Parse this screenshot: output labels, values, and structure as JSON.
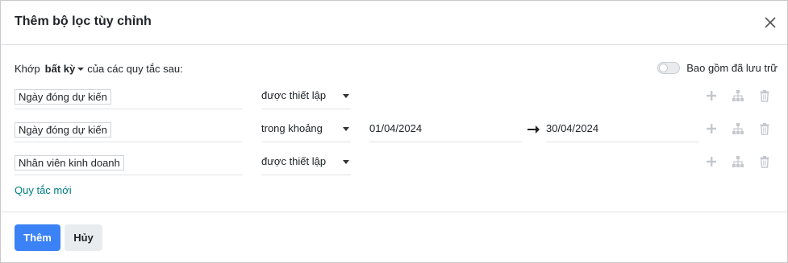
{
  "dialog": {
    "title": "Thêm bộ lọc tùy chỉnh",
    "close_icon": "close-icon"
  },
  "match": {
    "prefix": "Khớp",
    "selected": "bất kỳ",
    "suffix": "của các quy tắc sau:"
  },
  "archive": {
    "label": "Bao gồm đã lưu trữ",
    "enabled": false
  },
  "rules": [
    {
      "field": "Ngày đóng dự kiến",
      "operator": "được thiết lập"
    },
    {
      "field": "Ngày đóng dự kiến",
      "operator": "trong khoảng",
      "value_from": "01/04/2024",
      "value_to": "30/04/2024"
    },
    {
      "field": "Nhân viên kinh doanh",
      "operator": "được thiết lập"
    }
  ],
  "rule_actions": {
    "add_icon": "plus-icon",
    "branch_icon": "sitemap-icon",
    "delete_icon": "trash-icon"
  },
  "new_rule_label": "Quy tắc mới",
  "footer": {
    "add_label": "Thêm",
    "cancel_label": "Hủy"
  },
  "colors": {
    "primary": "#3b82f6",
    "link": "#017e84",
    "icon_muted": "#c4c8cc"
  }
}
